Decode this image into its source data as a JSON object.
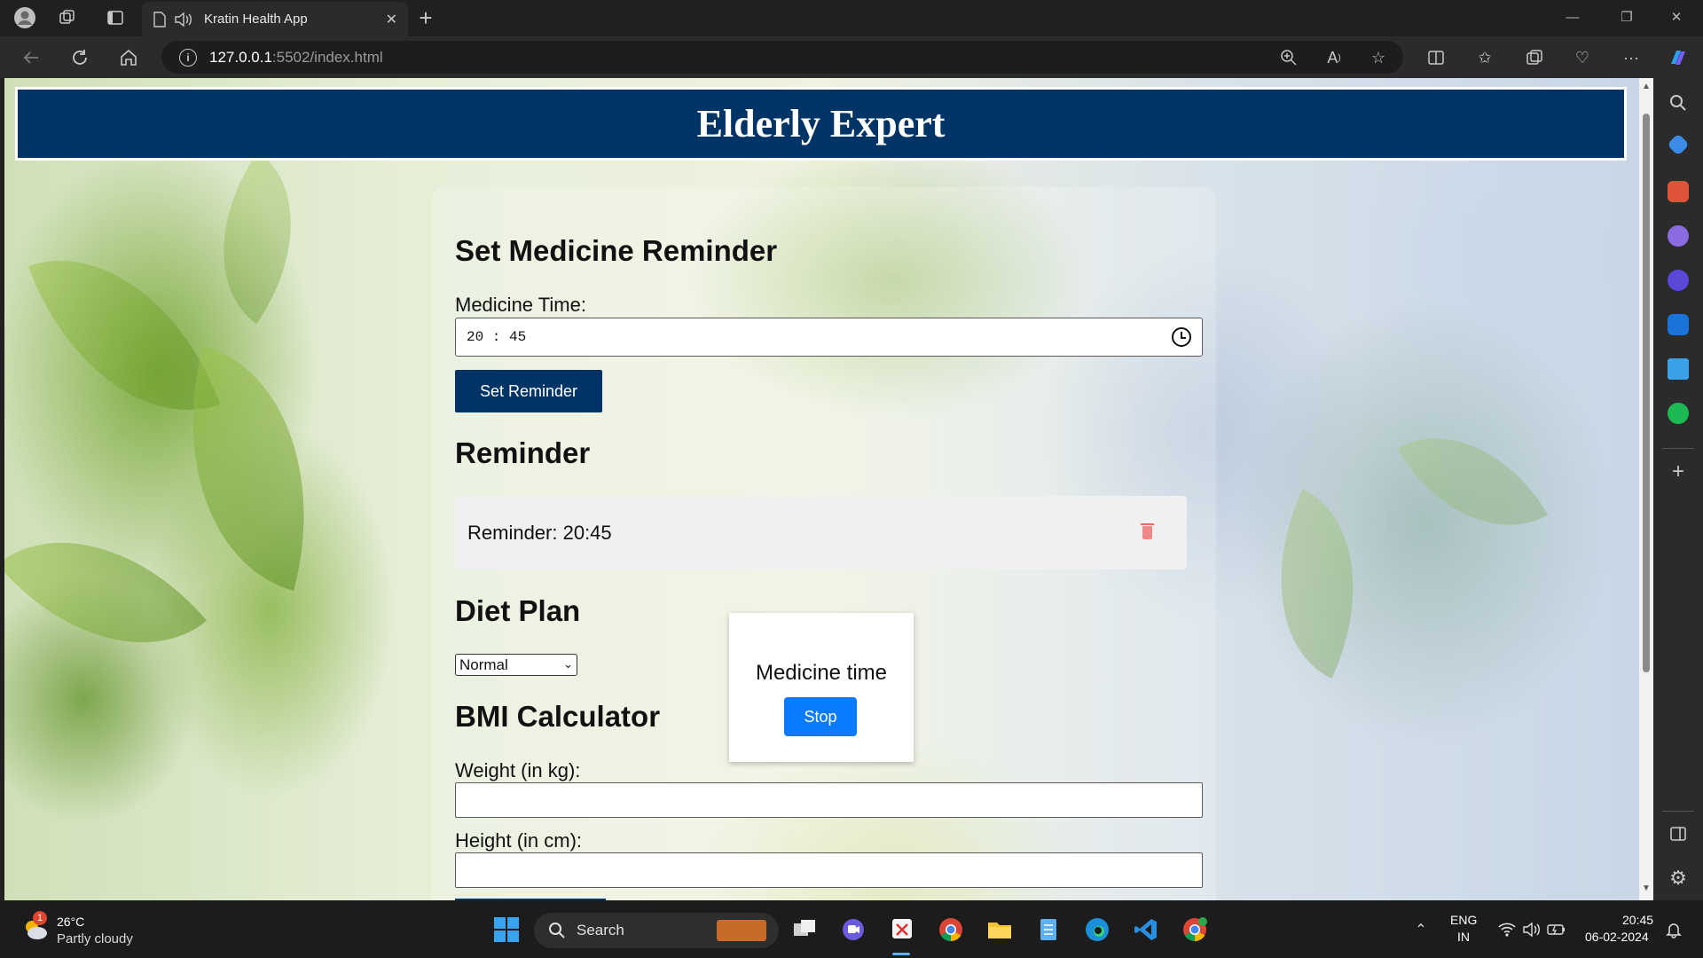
{
  "browser": {
    "tab_title": "Kratin Health App",
    "url_host": "127.0.0.1",
    "url_path": ":5502/index.html"
  },
  "page": {
    "header_title": "Elderly Expert",
    "reminder_form": {
      "title": "Set Medicine Reminder",
      "time_label": "Medicine Time:",
      "time_value": "20 : 45",
      "button_label": "Set Reminder"
    },
    "reminders": {
      "title": "Reminder",
      "items": [
        {
          "text": "Reminder: 20:45"
        }
      ]
    },
    "diet": {
      "title": "Diet Plan",
      "selected_option": "Normal"
    },
    "bmi": {
      "title": "BMI Calculator",
      "weight_label": "Weight (in kg):",
      "height_label": "Height (in cm):"
    },
    "alert_popup": {
      "message": "Medicine time",
      "button_label": "Stop"
    }
  },
  "taskbar": {
    "weather_temp": "26°C",
    "weather_desc": "Partly cloudy",
    "weather_badge": "1",
    "search_label": "Search",
    "lang_top": "ENG",
    "lang_bottom": "IN",
    "time": "20:45",
    "date": "06-02-2024"
  },
  "colors": {
    "header_bg": "#003366",
    "stop_button": "#0a7bff"
  }
}
